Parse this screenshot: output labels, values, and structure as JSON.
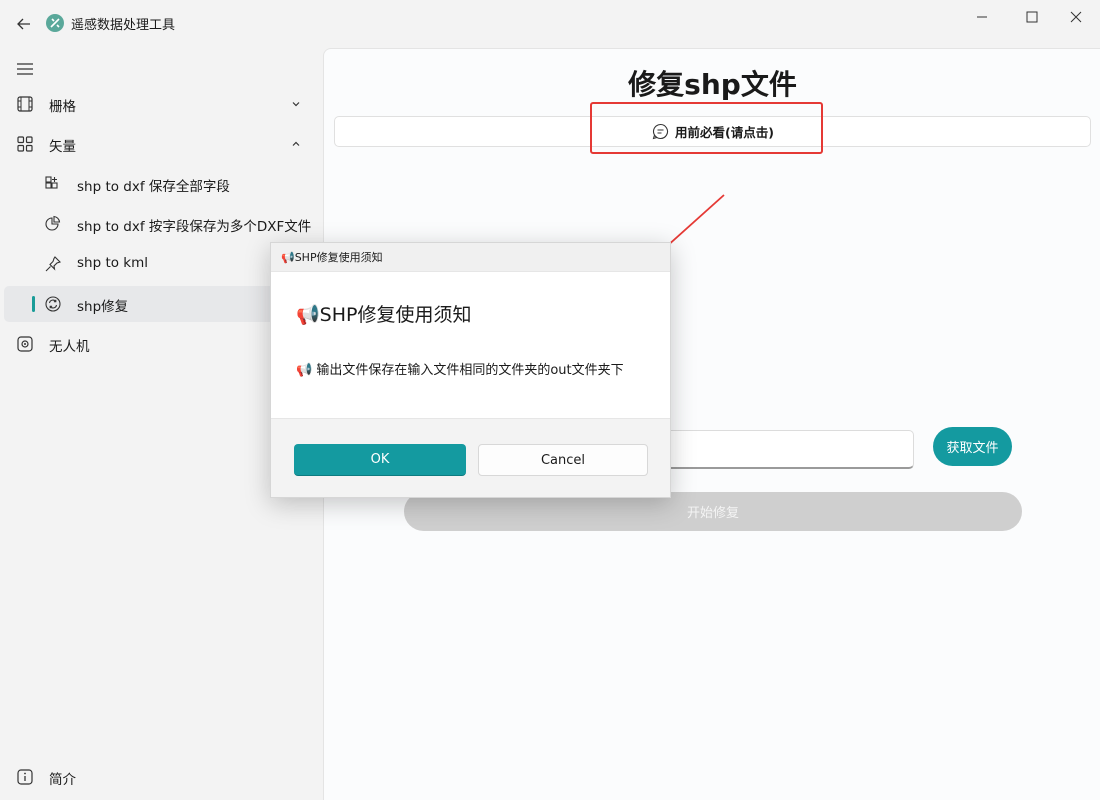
{
  "window": {
    "title": "遥感数据处理工具"
  },
  "sidebar": {
    "items": [
      {
        "label": "栅格",
        "icon": "film-icon"
      },
      {
        "label": "矢量",
        "icon": "grid-icon"
      },
      {
        "label": "shp to dxf 保存全部字段",
        "icon": "apps-add-icon"
      },
      {
        "label": "shp to dxf 按字段保存为多个DXF文件",
        "icon": "pie-chart-icon"
      },
      {
        "label": "shp to kml",
        "icon": "pin-icon"
      },
      {
        "label": "shp修复",
        "icon": "sync-icon"
      },
      {
        "label": "无人机",
        "icon": "target-icon"
      }
    ],
    "footer": {
      "label": "简介",
      "icon": "info-icon"
    }
  },
  "main": {
    "title": "修复shp文件",
    "notice_label": "用前必看(请点击)",
    "get_file_label": "获取文件",
    "start_label": "开始修复"
  },
  "dialog": {
    "title": "📢SHP修复使用须知",
    "heading": "📢SHP修复使用须知",
    "body": "📢 输出文件保存在输入文件相同的文件夹的out文件夹下",
    "ok_label": "OK",
    "cancel_label": "Cancel"
  },
  "colors": {
    "accent": "#149aa0",
    "highlight": "#e53935",
    "disabled": "#cfcfcf"
  }
}
